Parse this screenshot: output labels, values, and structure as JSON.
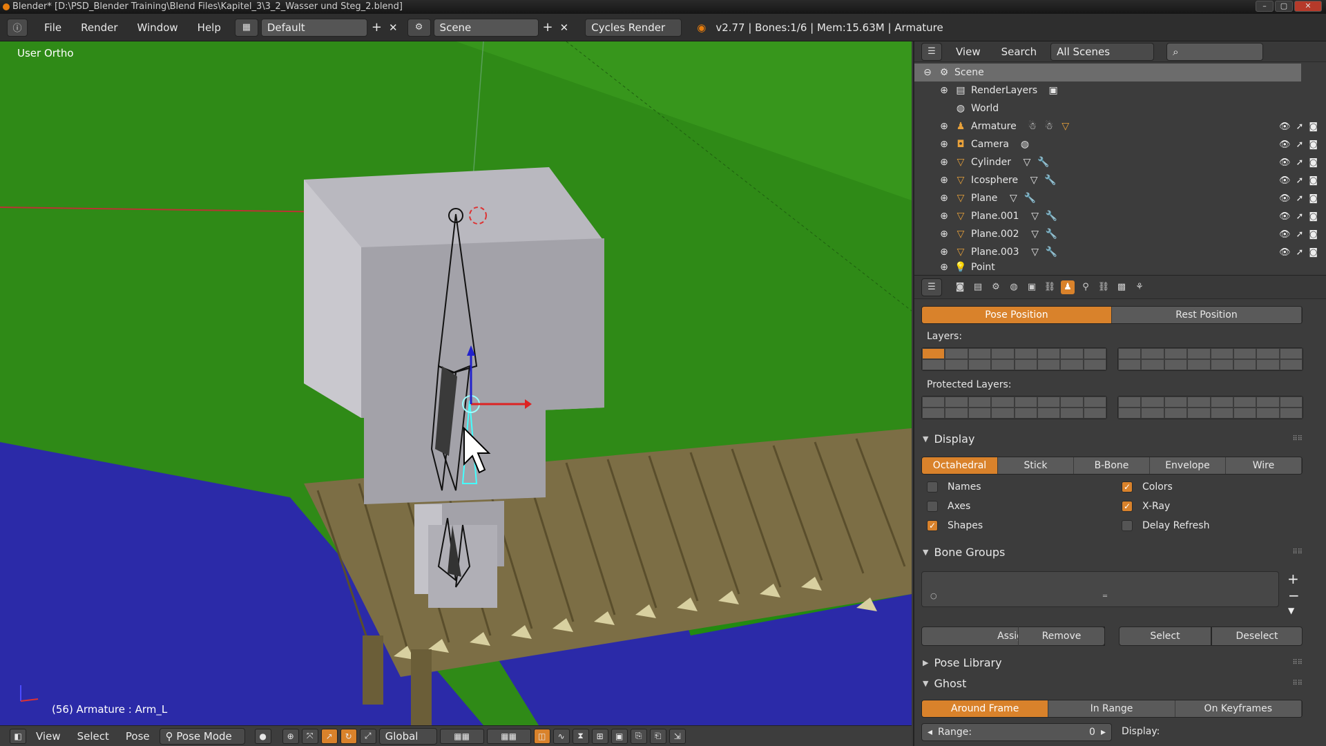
{
  "title_bar": {
    "text": "Blender* [D:\\PSD_Blender Training\\Blend Files\\Kapitel_3\\3_2_Wasser und Steg_2.blend]"
  },
  "info_header": {
    "menus": [
      "File",
      "Render",
      "Window",
      "Help"
    ],
    "screen_layout": "Default",
    "scene": "Scene",
    "render_engine": "Cycles Render",
    "stats": "v2.77 | Bones:1/6  | Mem:15.63M | Armature"
  },
  "viewport": {
    "view_name": "User Ortho",
    "status": "(56) Armature : Arm_L",
    "colors": {
      "ground": "#2f8a17",
      "water": "#2b2aa8",
      "figure": "#a3a2a9",
      "planks": "#7c6e45"
    }
  },
  "viewport_header": {
    "menus": [
      "View",
      "Select",
      "Pose"
    ],
    "mode": "Pose Mode",
    "orientation": "Global"
  },
  "outliner": {
    "menus": [
      "View",
      "Search"
    ],
    "display_mode": "All Scenes",
    "items": [
      {
        "name": "Scene",
        "icon": "scene-icon"
      },
      {
        "name": "RenderLayers",
        "icon": "render-layers-icon"
      },
      {
        "name": "World",
        "icon": "world-icon"
      },
      {
        "name": "Armature",
        "icon": "armature-icon"
      },
      {
        "name": "Camera",
        "icon": "camera-icon"
      },
      {
        "name": "Cylinder",
        "icon": "mesh-icon"
      },
      {
        "name": "Icosphere",
        "icon": "mesh-icon"
      },
      {
        "name": "Plane",
        "icon": "mesh-icon"
      },
      {
        "name": "Plane.001",
        "icon": "mesh-icon"
      },
      {
        "name": "Plane.002",
        "icon": "mesh-icon"
      },
      {
        "name": "Plane.003",
        "icon": "mesh-icon"
      },
      {
        "name": "Point",
        "icon": "lamp-icon"
      }
    ]
  },
  "properties": {
    "pose_toggle": [
      "Pose Position",
      "Rest Position"
    ],
    "layers_label": "Layers:",
    "protected_layers_label": "Protected Layers:",
    "display": {
      "title": "Display",
      "draw_types": [
        "Octahedral",
        "Stick",
        "B-Bone",
        "Envelope",
        "Wire"
      ],
      "names": "Names",
      "axes": "Axes",
      "shapes": "Shapes",
      "colors": "Colors",
      "xray": "X-Ray",
      "delay_refresh": "Delay Refresh"
    },
    "bone_groups": {
      "title": "Bone Groups",
      "buttons": [
        "Assign",
        "Remove",
        "Select",
        "Deselect"
      ]
    },
    "pose_library": {
      "title": "Pose Library"
    },
    "ghost": {
      "title": "Ghost",
      "types": [
        "Around Frame",
        "In Range",
        "On Keyframes"
      ],
      "range_label": "Range:",
      "range_value": "0",
      "display_label": "Display:"
    },
    "accent_color": "#d9822b"
  }
}
